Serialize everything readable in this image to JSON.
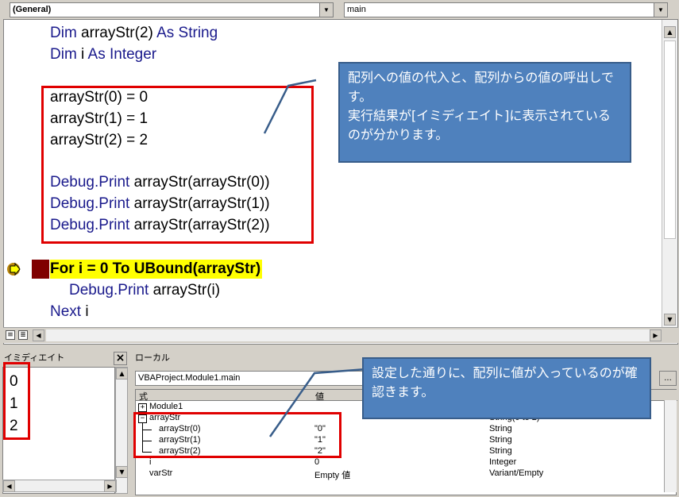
{
  "combo": {
    "object": "(General)",
    "procedure": "main"
  },
  "code": {
    "line1_kw": "Dim",
    "line1_rest": " arrayStr(2) ",
    "line1_kw2": "As String",
    "line2_kw": "Dim",
    "line2_rest": " i ",
    "line2_kw2": "As Integer",
    "assign": [
      "arrayStr(0) = 0",
      "arrayStr(1) = 1",
      "arrayStr(2) = 2"
    ],
    "debug_kw": "Debug.Print",
    "debug_args": [
      " arrayStr(arrayStr(0))",
      " arrayStr(arrayStr(1))",
      " arrayStr(arrayStr(2))"
    ],
    "for_line": "For i = 0 To UBound(arrayStr)",
    "body_kw": "Debug.Print",
    "body_rest": " arrayStr(i)",
    "next_kw": "Next",
    "next_rest": " i"
  },
  "callout_top": "配列への値の代入と、配列からの値の呼出しです。\n実行結果が[イミディエイト]に表示されているのが分かります。",
  "callout_bottom": "設定した通りに、配列に値が入っているのが確認きます。",
  "immediate": {
    "title": "イミディエイト",
    "lines": [
      "0",
      "1",
      "2"
    ]
  },
  "locals": {
    "title": "ローカル",
    "context": "VBAProject.Module1.main",
    "col_expr": "式",
    "col_value": "値",
    "rows": [
      {
        "expr": "Module1",
        "value": "",
        "type": ""
      },
      {
        "expr": "arrayStr",
        "value": "",
        "type": "String(0 to 2)"
      },
      {
        "expr": "arrayStr(0)",
        "value": "\"0\"",
        "type": "String"
      },
      {
        "expr": "arrayStr(1)",
        "value": "\"1\"",
        "type": "String"
      },
      {
        "expr": "arrayStr(2)",
        "value": "\"2\"",
        "type": "String"
      },
      {
        "expr": "i",
        "value": "0",
        "type": "Integer"
      },
      {
        "expr": "varStr",
        "value": "Empty 値",
        "type": "Variant/Empty"
      }
    ]
  },
  "colors": {
    "keyword": "#1a1a8c",
    "highlight": "#ffff00",
    "breakpoint": "#800000",
    "callout": "#4f81bd",
    "redbox": "#e00000"
  }
}
